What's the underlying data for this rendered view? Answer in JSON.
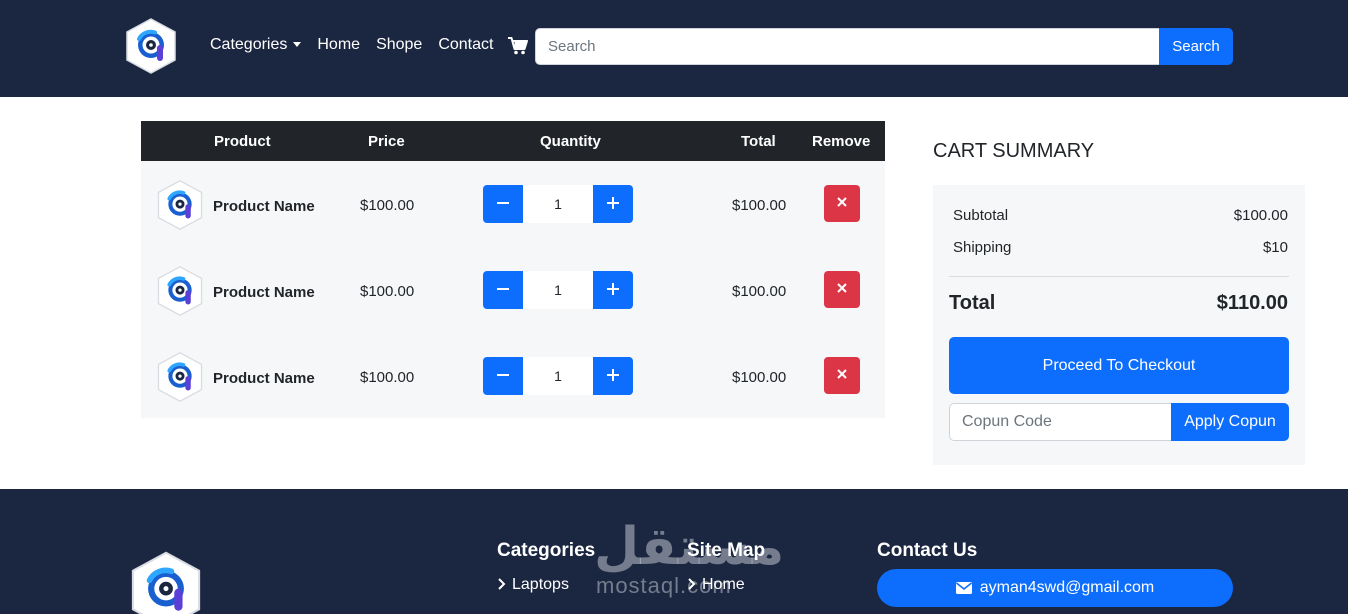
{
  "nav": {
    "categories": "Categories",
    "home": "Home",
    "shope": "Shope",
    "contact": "Contact",
    "search_placeholder": "Search",
    "search_button": "Search"
  },
  "cart": {
    "headers": {
      "product": "Product",
      "price": "Price",
      "quantity": "Quantity",
      "total": "Total",
      "remove": "Remove"
    },
    "rows": [
      {
        "name": "Product Name",
        "price": "$100.00",
        "qty": "1",
        "total": "$100.00"
      },
      {
        "name": "Product Name",
        "price": "$100.00",
        "qty": "1",
        "total": "$100.00"
      },
      {
        "name": "Product Name",
        "price": "$100.00",
        "qty": "1",
        "total": "$100.00"
      }
    ]
  },
  "summary": {
    "title": "CART SUMMARY",
    "subtotal_label": "Subtotal",
    "subtotal_value": "$100.00",
    "shipping_label": "Shipping",
    "shipping_value": "$10",
    "total_label": "Total",
    "total_value": "$110.00",
    "checkout_button": "Proceed To Checkout",
    "coupon_placeholder": "Copun Code",
    "coupon_button": "Apply Copun"
  },
  "footer": {
    "categories_heading": "Categories",
    "categories_link": "Laptops",
    "sitemap_heading": "Site Map",
    "sitemap_link": "Home",
    "contact_heading": "Contact Us",
    "email": "ayman4swd@gmail.com"
  },
  "watermark": {
    "arabic": "مستقل",
    "latin": "mostaql.com"
  },
  "colors": {
    "navbar": "#1b2740",
    "primary": "#0d6efd",
    "danger": "#dc3545",
    "table_header": "#212529",
    "panel": "#f6f7f8"
  },
  "icons": [
    "brand-logo-icon",
    "cart-icon",
    "minus-icon",
    "plus-icon",
    "close-icon",
    "chevron-right-icon",
    "envelope-icon"
  ]
}
